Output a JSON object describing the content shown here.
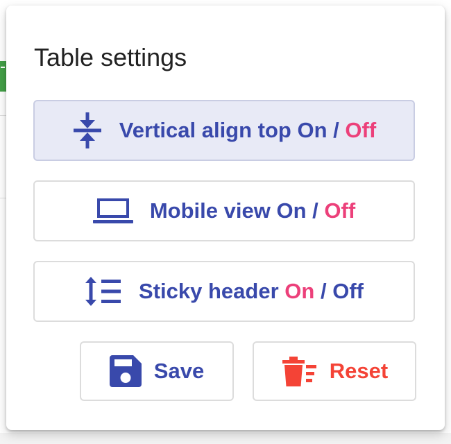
{
  "popover": {
    "title": "Table settings"
  },
  "options": {
    "vertical_align": {
      "label": "Vertical align top",
      "on": "On",
      "separator": "/",
      "off": "Off",
      "state": "Off",
      "icon": "vertical-align-center-icon"
    },
    "mobile_view": {
      "label": "Mobile view",
      "on": "On",
      "separator": "/",
      "off": "Off",
      "state": "Off",
      "icon": "laptop-icon"
    },
    "sticky_header": {
      "label": "Sticky header",
      "on": "On",
      "separator": "/",
      "off": "Off",
      "state": "On",
      "icon": "line-height-icon"
    }
  },
  "actions": {
    "save_label": "Save",
    "save_icon": "floppy-disk-icon",
    "reset_label": "Reset",
    "reset_icon": "delete-sweep-icon"
  },
  "colors": {
    "primary": "#3949ab",
    "highlight": "#ec407a",
    "danger": "#f44336",
    "active_bg": "#e8eaf6"
  }
}
